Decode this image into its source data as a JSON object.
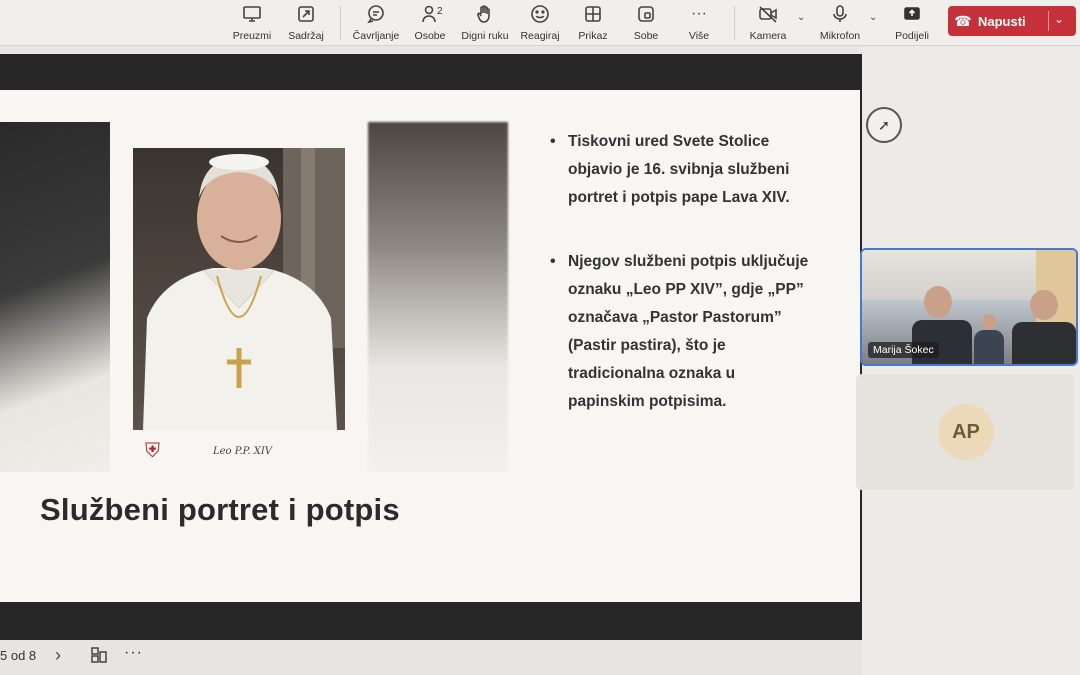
{
  "toolbar": {
    "items": [
      {
        "label": "Preuzmi",
        "icon": "present-screen-icon"
      },
      {
        "label": "Sadržaj",
        "icon": "share-content-icon"
      },
      {
        "label": "Čavrljanje",
        "icon": "chat-icon"
      },
      {
        "label": "Osobe",
        "icon": "people-icon",
        "count": "2"
      },
      {
        "label": "Digni ruku",
        "icon": "raise-hand-icon"
      },
      {
        "label": "Reagiraj",
        "icon": "smiley-icon"
      },
      {
        "label": "Prikaz",
        "icon": "view-grid-icon"
      },
      {
        "label": "Sobe",
        "icon": "rooms-icon"
      },
      {
        "label": "Više",
        "icon": "more-icon"
      },
      {
        "label": "Kamera",
        "icon": "camera-off-icon"
      },
      {
        "label": "Mikrofon",
        "icon": "microphone-icon"
      },
      {
        "label": "Podijeli",
        "icon": "share-icon"
      }
    ],
    "leave_label": "Napusti",
    "leave_color": "#c4313b"
  },
  "slide": {
    "title": "Službeni portret i potpis",
    "signature": "Leo P.P. XIV",
    "bullets": [
      "Tiskovni ured Svete Stolice objavio je 16. svibnja službeni portret i potpis pape Lava XIV.",
      "Njegov službeni potpis uključuje oznaku „Leo PP XIV”, gdje „PP” označava „Pastor Pastorum” (Pastir pastira), što je tradicionalna oznaka u papinskim potpisima."
    ]
  },
  "bottom": {
    "page_counter": "5 od 8",
    "next_glyph": "›",
    "more_glyph": "···"
  },
  "participants": {
    "video_name": "Marija Šokec",
    "avatar_initials": "AP",
    "avatar_color": "#ecd9b9"
  }
}
